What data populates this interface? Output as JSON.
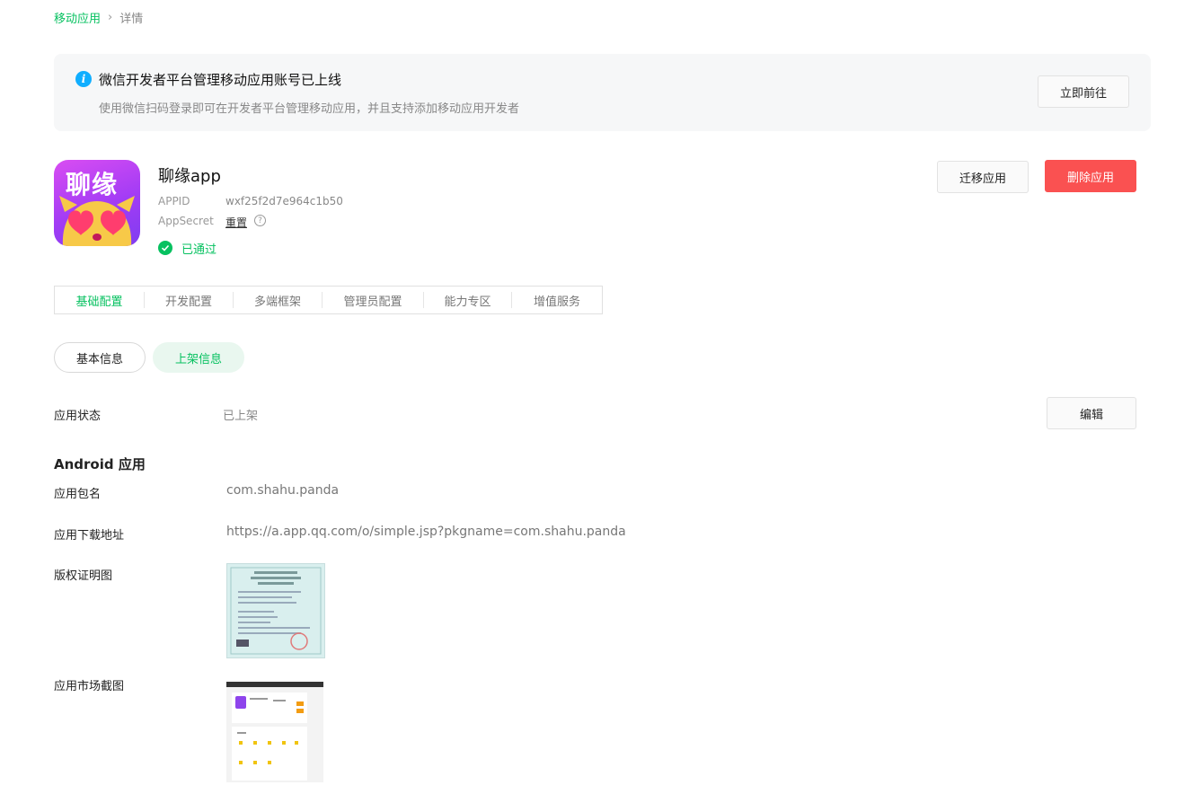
{
  "breadcrumb": {
    "parent": "移动应用",
    "separator": "›",
    "current": "详情"
  },
  "notice": {
    "icon": "info-icon",
    "icon_glyph": "i",
    "title": "微信开发者平台管理移动应用账号已上线",
    "description": "使用微信扫码登录即可在开发者平台管理移动应用，并且支持添加移动应用开发者",
    "button_label": "立即前往"
  },
  "app": {
    "icon_text": "聊缘",
    "name": "聊缘app",
    "appid_label": "APPID",
    "appid_value": "wxf25f2d7e964c1b50",
    "appsecret_label": "AppSecret",
    "reset_label": "重置",
    "help_glyph": "?",
    "status_text": "已通过",
    "migrate_label": "迁移应用",
    "delete_label": "删除应用"
  },
  "tabs": [
    {
      "label": "基础配置",
      "active": true
    },
    {
      "label": "开发配置",
      "active": false
    },
    {
      "label": "多端框架",
      "active": false
    },
    {
      "label": "管理员配置",
      "active": false
    },
    {
      "label": "能力专区",
      "active": false
    },
    {
      "label": "增值服务",
      "active": false
    }
  ],
  "subtabs": {
    "basic": "基本信息",
    "listing": "上架信息"
  },
  "status_row": {
    "label": "应用状态",
    "value": "已上架",
    "edit_label": "编辑"
  },
  "android": {
    "section_title": "Android 应用",
    "package_label": "应用包名",
    "package_value": "com.shahu.panda",
    "download_label": "应用下载地址",
    "download_value": "https://a.app.qq.com/o/simple.jsp?pkgname=com.shahu.panda",
    "copyright_label": "版权证明图",
    "screenshot_label": "应用市场截图"
  },
  "colors": {
    "accent": "#07c160",
    "danger": "#fa5151",
    "info": "#10aeff"
  }
}
